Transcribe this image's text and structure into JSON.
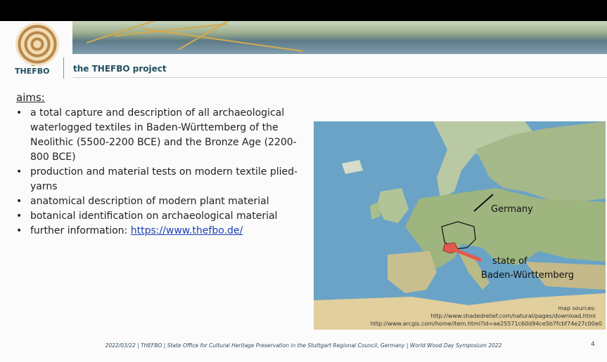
{
  "header": {
    "logo_text": "THEFBO",
    "project_title": "the THEFBO project"
  },
  "content": {
    "heading": "aims:",
    "bullets": [
      "a total capture and description of all archaeological waterlogged textiles in Baden-Württemberg of the Neolithic (5500-2200 BCE) and the Bronze Age (2200-800 BCE)",
      "production and material tests on modern textile plied-yarns",
      "anatomical description of modern plant material",
      "botanical identification on archaeological material"
    ],
    "further_label": "further information: ",
    "further_link": "https://www.thefbo.de/"
  },
  "map": {
    "label_germany": "Germany",
    "label_state_1": "state of",
    "label_state_2": "Baden-Württemberg",
    "sources_title": "map sources:",
    "source_1": "http://www.shadedrelief.com/natural/pages/download.html",
    "source_2": "http://www.arcgis.com/home/item.html?id=ae25571c60d94ce5b7fcbf74e27c00e0"
  },
  "footer": {
    "text": "2022/03/22 | THEFBO | State Office for Cultural Heritage Preservation in the Stuttgart Regional Council, Germany | World Wood Day Symposium 2022",
    "page_number": "4"
  },
  "colors": {
    "accent": "#1f4f5f",
    "link": "#1a3fb5",
    "state_highlight": "#e05a52"
  }
}
